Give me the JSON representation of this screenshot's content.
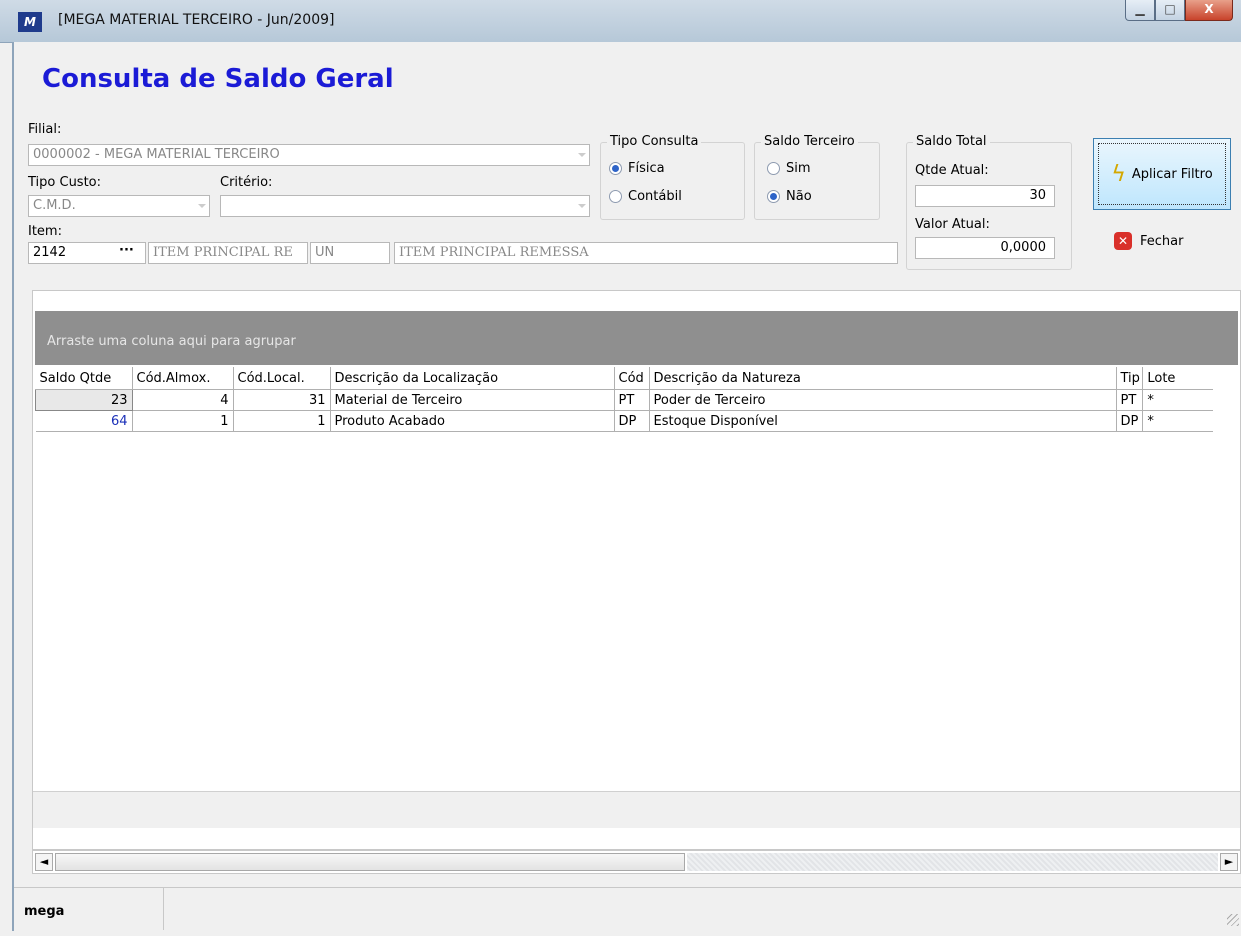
{
  "window": {
    "icon": "app-logo-icon",
    "title": "[MEGA MATERIAL TERCEIRO - Jun/2009]",
    "controls": {
      "minimize": "▁",
      "maximize": "□",
      "close": "X"
    }
  },
  "page_title": "Consulta de Saldo Geral",
  "filial": {
    "label": "Filial:",
    "value": "0000002 - MEGA MATERIAL TERCEIRO"
  },
  "tipo_custo": {
    "label": "Tipo Custo:",
    "value": "C.M.D."
  },
  "criterio": {
    "label": "Critério:",
    "value": ""
  },
  "item": {
    "label": "Item:",
    "code": "2142",
    "lookup": "···",
    "short_desc": "ITEM PRINCIPAL RE",
    "unit": "UN",
    "desc": "ITEM PRINCIPAL REMESSA"
  },
  "tipo_consulta": {
    "legend": "Tipo Consulta",
    "options": [
      {
        "label": "Física",
        "checked": true
      },
      {
        "label": "Contábil",
        "checked": false
      }
    ]
  },
  "saldo_terceiro": {
    "legend": "Saldo Terceiro",
    "options": [
      {
        "label": "Sim",
        "checked": false
      },
      {
        "label": "Não",
        "checked": true
      }
    ]
  },
  "saldo_total": {
    "legend": "Saldo Total",
    "qtde_label": "Qtde Atual:",
    "qtde_value": "30",
    "valor_label": "Valor Atual:",
    "valor_value": "0,0000"
  },
  "buttons": {
    "apply": "Aplicar Filtro",
    "close": "Fechar"
  },
  "grid": {
    "group_hint": "Arraste uma coluna aqui para agrupar",
    "columns": [
      "Saldo Qtde",
      "Cód.Almox.",
      "Cód.Local.",
      "Descrição da Localização",
      "Cód",
      "Descrição da Natureza",
      "Tip",
      "Lote"
    ],
    "rows": [
      [
        "23",
        "4",
        "31",
        "Material de Terceiro",
        "PT",
        "Poder de Terceiro",
        "PT",
        "*"
      ],
      [
        "64",
        "1",
        "1",
        "Produto Acabado",
        "DP",
        "Estoque Disponível",
        "DP",
        "*"
      ]
    ]
  },
  "scrollbar": {
    "left": "◄",
    "right": "►"
  },
  "status": {
    "user": "mega"
  }
}
